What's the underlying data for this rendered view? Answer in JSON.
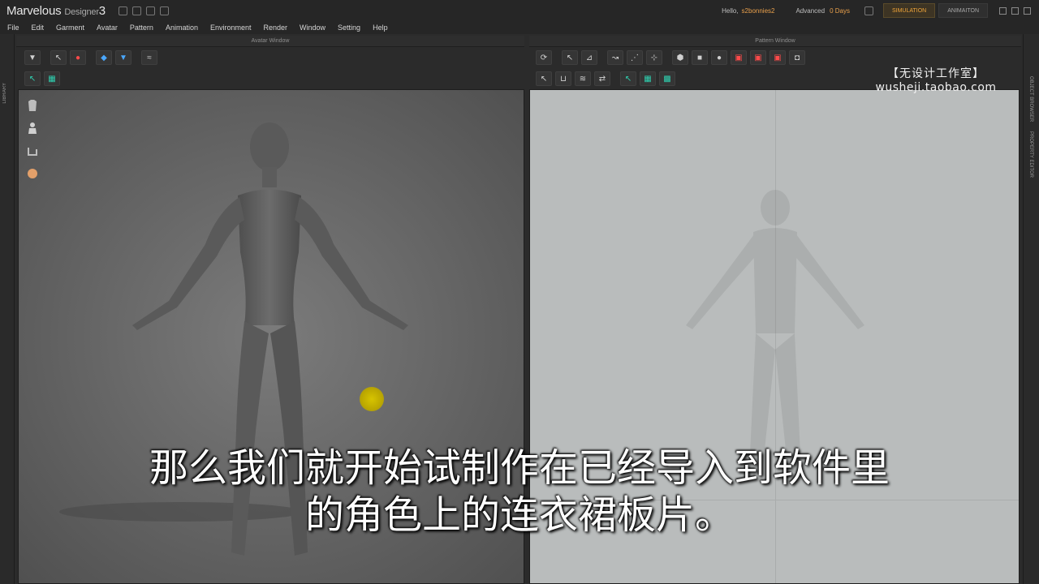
{
  "titlebar": {
    "app_name": "Marvelous",
    "app_sub": "Designer",
    "app_version": "3",
    "hello": "Hello,",
    "username": "s2bonnies2",
    "plan": "Advanced",
    "days": "0 Days",
    "mode_simulation": "SIMULATION",
    "mode_animation": "ANIMAITON"
  },
  "menu": [
    "File",
    "Edit",
    "Garment",
    "Avatar",
    "Pattern",
    "Animation",
    "Environment",
    "Render",
    "Window",
    "Setting",
    "Help"
  ],
  "panels": {
    "avatar_window": "Avatar Window",
    "pattern_window": "Pattern Window",
    "left_strip": "LIBRARY",
    "right_strip_1": "OBJECT BROWSER",
    "right_strip_2": "PROPERTY EDITOR"
  },
  "watermark": {
    "cn": "【无设计工作室】",
    "url": "wusheji.taobao.com"
  },
  "subtitle": {
    "line1": "那么我们就开始试制作在已经导入到软件里",
    "line2": "的角色上的连衣裙板片。"
  },
  "icons": {
    "toolbar_avatar": [
      "arrow-down-icon",
      "select-icon",
      "record-icon",
      "transform-icon",
      "gizmo-icon",
      "fold-icon"
    ],
    "toolbar_pattern": [
      "refresh-icon",
      "select-pattern-icon",
      "edit-pattern-icon",
      "curve-icon",
      "point-icon",
      "polygon-icon",
      "rectangle-icon",
      "circle-icon",
      "internal-polygon-icon",
      "dart-icon"
    ]
  }
}
